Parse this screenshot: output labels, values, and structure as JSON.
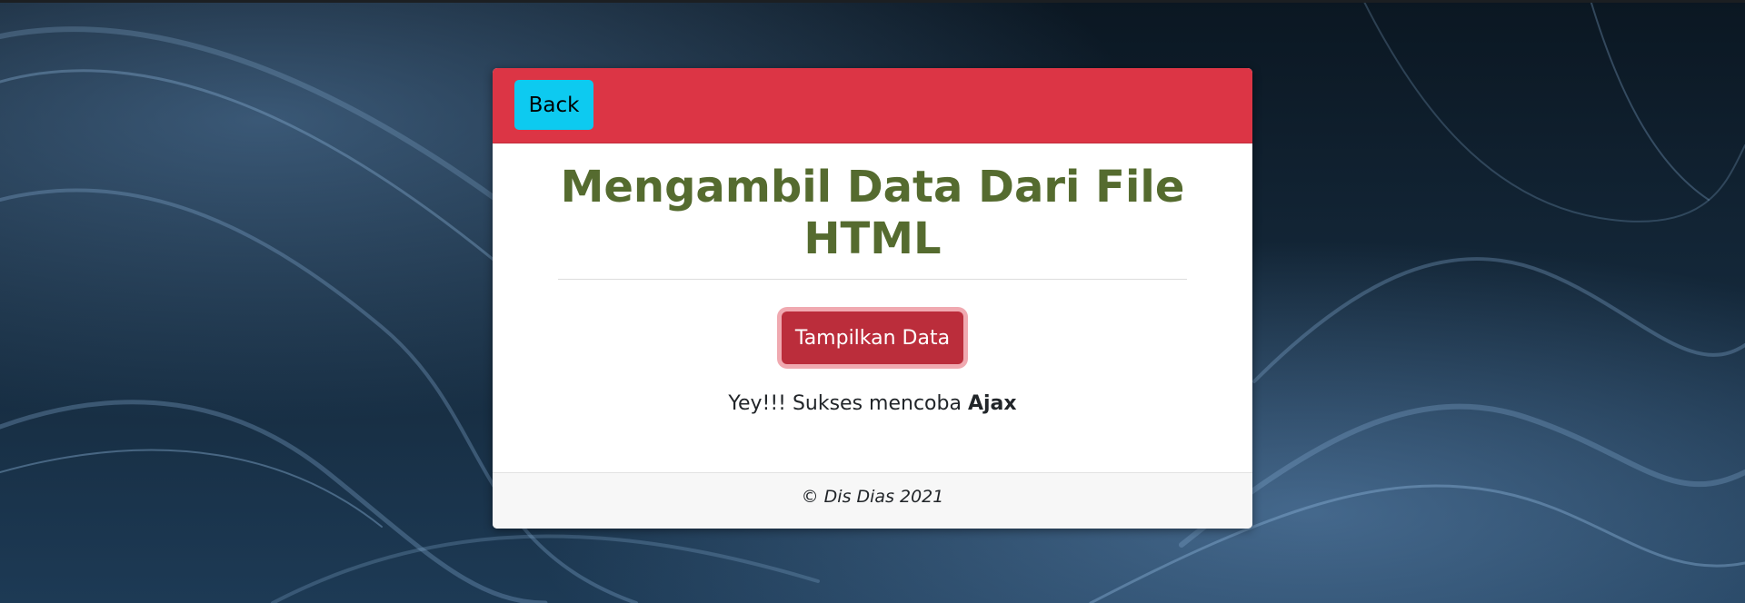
{
  "header": {
    "back_label": "Back",
    "accent_color": "#dc3545",
    "back_color": "#0dcaf0"
  },
  "main": {
    "title_line1": "Mengambil Data Dari File",
    "title_line2": "HTML",
    "title_color": "#556b2f",
    "button_label": "Tampilkan Data",
    "button_color": "#bb2d3b",
    "result_text": "Yey!!! Sukses mencoba ",
    "result_bold": "Ajax"
  },
  "footer": {
    "text": "© Dis Dias 2021"
  }
}
